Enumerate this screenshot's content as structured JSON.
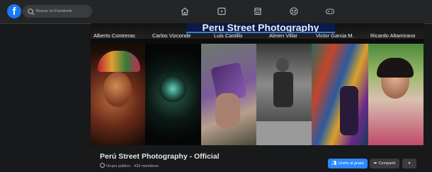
{
  "nav": {
    "logo_letter": "f",
    "search_placeholder": "Buscar en Facebook",
    "icons": [
      "home-icon",
      "watch-icon",
      "marketplace-icon",
      "groups-icon",
      "gaming-icon"
    ]
  },
  "cover": {
    "title": "Peru Street Photography",
    "photographers": [
      "Alberto Contreras",
      "Carlos Vizconde",
      "Luis Castillo",
      "Almen Villar",
      "Victor Garcia M.",
      "Ricardo Altamirano"
    ]
  },
  "group": {
    "name": "Perú Street Photography - Official",
    "meta": "Grupo público · 433 miembros",
    "join_label": "Unirte al grupo",
    "share_label": "Compartir",
    "more_label": "▾"
  },
  "colors": {
    "background": "#18191a",
    "topbar": "#242526",
    "accent": "#2d88ff"
  }
}
